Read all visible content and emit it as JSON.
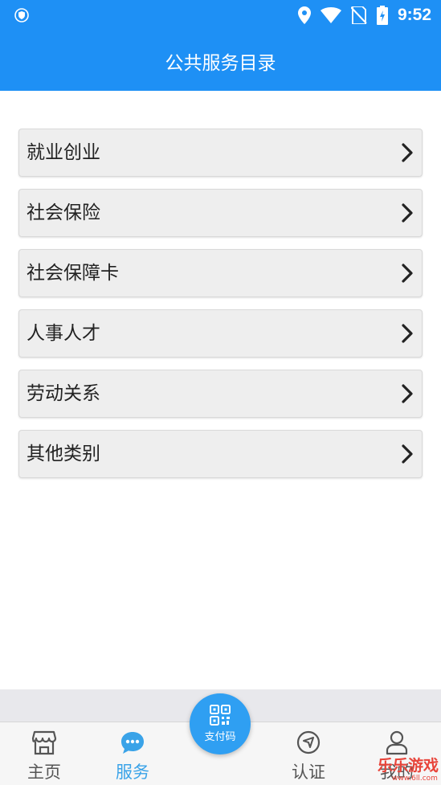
{
  "status_bar": {
    "time": "9:52",
    "icons": [
      "shield-icon",
      "location-icon",
      "wifi-icon",
      "no-sim-icon",
      "battery-icon"
    ]
  },
  "header": {
    "title": "公共服务目录"
  },
  "menu": {
    "items": [
      {
        "label": "就业创业"
      },
      {
        "label": "社会保险"
      },
      {
        "label": "社会保障卡"
      },
      {
        "label": "人事人才"
      },
      {
        "label": "劳动关系"
      },
      {
        "label": "其他类别"
      }
    ]
  },
  "pay_button": {
    "label": "支付码"
  },
  "tabs": [
    {
      "label": "主页",
      "icon": "store-icon",
      "active": false
    },
    {
      "label": "服务",
      "icon": "chat-icon",
      "active": true
    },
    {
      "label": "认证",
      "icon": "navigation-icon",
      "active": false
    },
    {
      "label": "我的",
      "icon": "user-icon",
      "active": false
    }
  ],
  "watermark": {
    "title": "乐乐游戏",
    "url": "www.6ll.com"
  },
  "colors": {
    "primary": "#1e90f5",
    "active_tab": "#3aa3e8",
    "menu_bg": "#eeeeee",
    "watermark": "#e8443a"
  }
}
